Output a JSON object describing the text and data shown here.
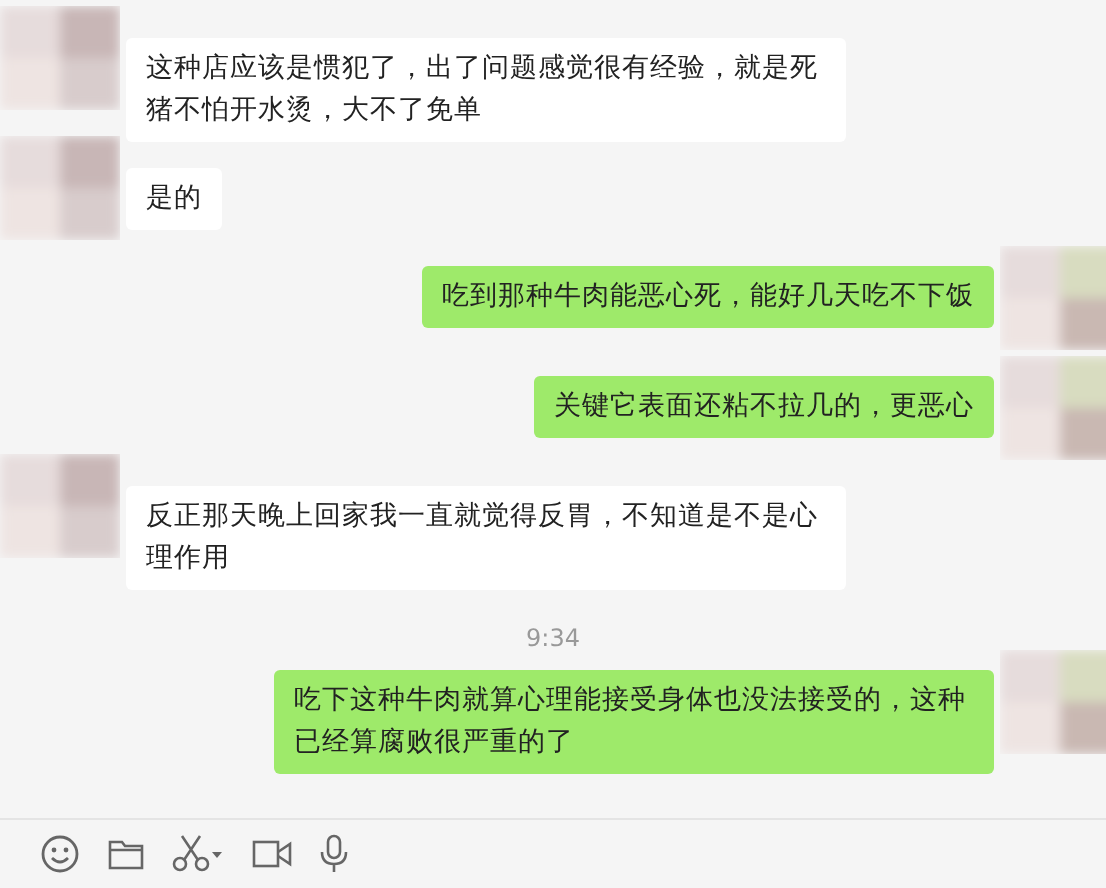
{
  "messages": [
    {
      "kind": "received",
      "text": "这种店应该是惯犯了，出了问题感觉很有经验，就是死猪不怕开水烫，大不了免单"
    },
    {
      "kind": "received",
      "text": "是的"
    },
    {
      "kind": "sent",
      "text": "吃到那种牛肉能恶心死，能好几天吃不下饭"
    },
    {
      "kind": "sent",
      "text": "关键它表面还粘不拉几的，更恶心"
    },
    {
      "kind": "received",
      "text": "反正那天晚上回家我一直就觉得反胃，不知道是不是心理作用"
    },
    {
      "kind": "time",
      "text": "9:34"
    },
    {
      "kind": "sent",
      "text": "吃下这种牛肉就算心理能接受身体也没法接受的，这种已经算腐败很严重的了"
    }
  ]
}
